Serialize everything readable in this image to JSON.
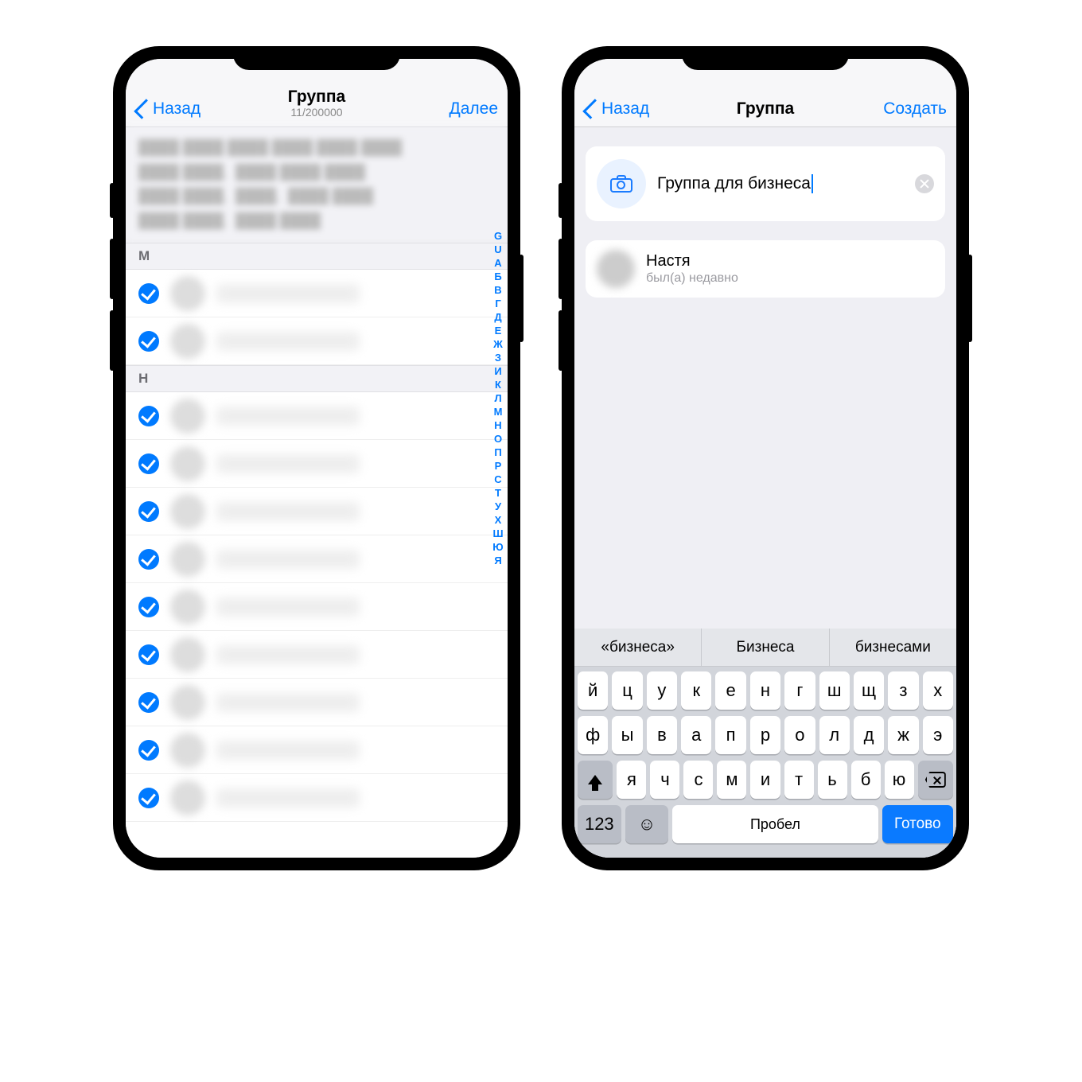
{
  "left": {
    "nav": {
      "back": "Назад",
      "title": "Группа",
      "sub": "11/200000",
      "next": "Далее"
    },
    "sections": [
      {
        "letter": "М",
        "rows": 2
      },
      {
        "letter": "Н",
        "rows": 9
      }
    ],
    "index_letters": [
      "G",
      "U",
      "А",
      "Б",
      "В",
      "Г",
      "Д",
      "Е",
      "Ж",
      "З",
      "И",
      "К",
      "Л",
      "М",
      "Н",
      "О",
      "П",
      "Р",
      "С",
      "Т",
      "У",
      "Х",
      "Ш",
      "Ю",
      "Я"
    ]
  },
  "right": {
    "nav": {
      "back": "Назад",
      "title": "Группа",
      "action": "Создать"
    },
    "group_name_value": "Группа для бизнеса",
    "member": {
      "name": "Настя",
      "status": "был(а) недавно"
    },
    "keyboard": {
      "suggestions": [
        "«бизнеса»",
        "Бизнеса",
        "бизнесами"
      ],
      "row1": [
        "й",
        "ц",
        "у",
        "к",
        "е",
        "н",
        "г",
        "ш",
        "щ",
        "з",
        "х"
      ],
      "row2": [
        "ф",
        "ы",
        "в",
        "а",
        "п",
        "р",
        "о",
        "л",
        "д",
        "ж",
        "э"
      ],
      "row3": [
        "я",
        "ч",
        "с",
        "м",
        "и",
        "т",
        "ь",
        "б",
        "ю"
      ],
      "numbers": "123",
      "space": "Пробел",
      "done": "Готово"
    }
  }
}
